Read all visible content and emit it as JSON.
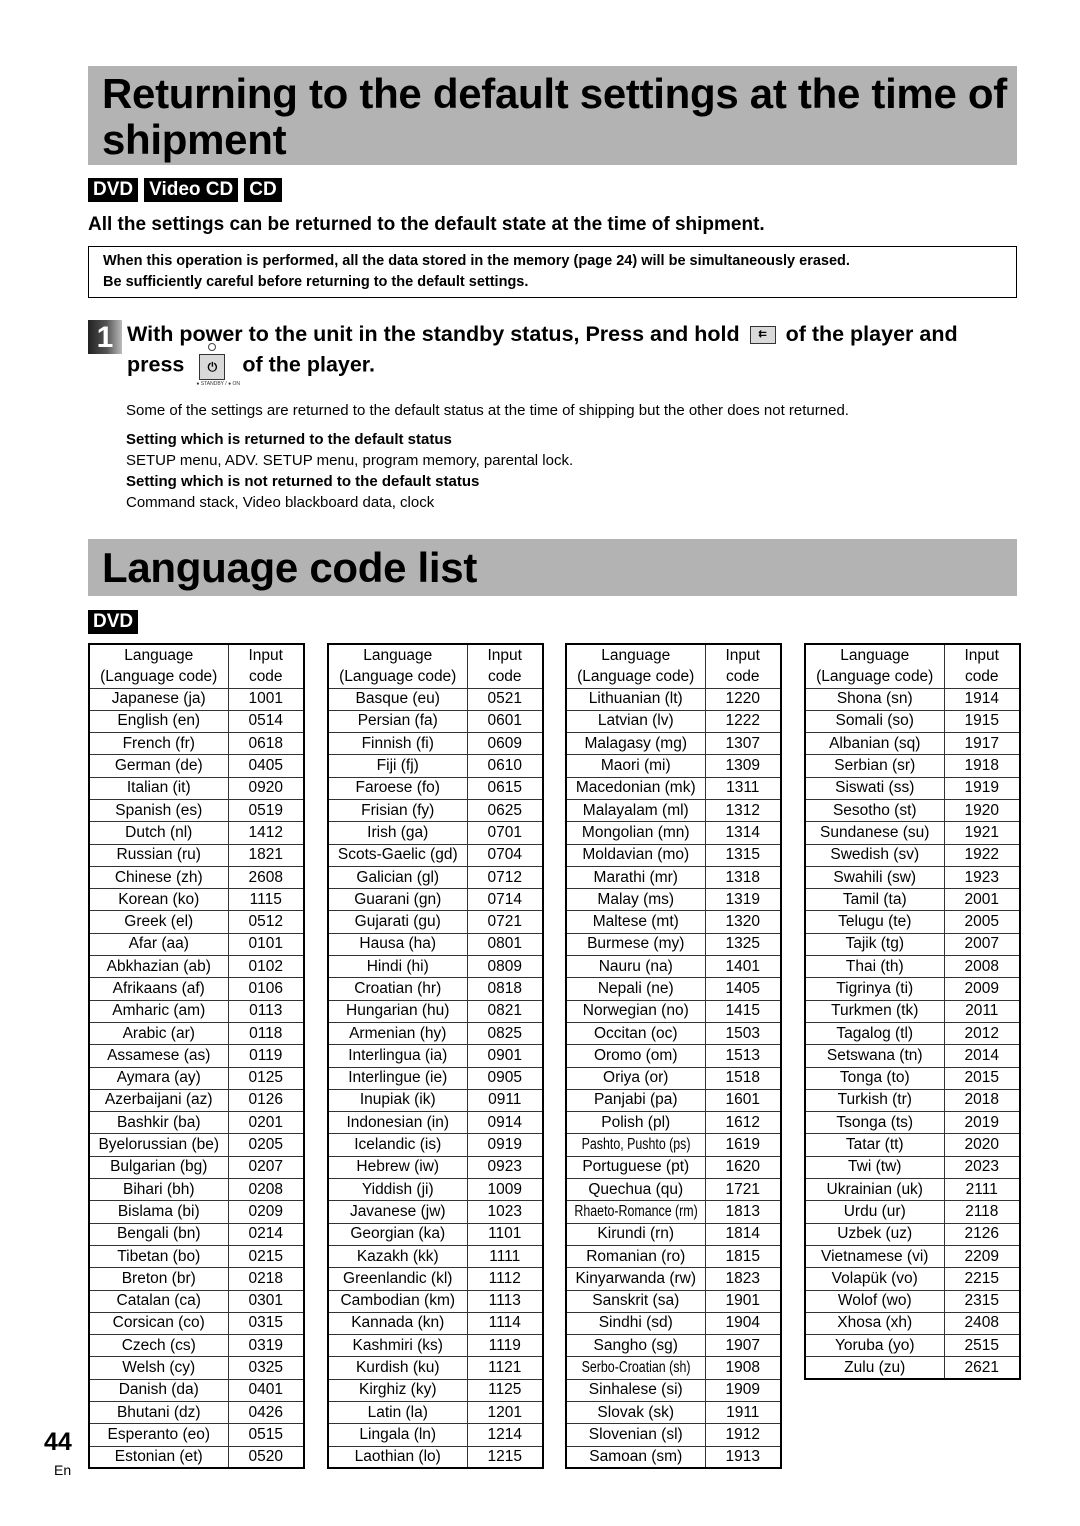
{
  "section1": {
    "title": "Returning to the default settings at the time of shipment",
    "badges": [
      "DVD",
      "Video CD",
      "CD"
    ],
    "lead": "All the settings can be returned to the default state at the time of shipment.",
    "warning_lines": [
      "When this operation is performed, all the data stored in the memory (page 24) will be simultaneously erased.",
      "Be sufficiently careful before returning to the default settings."
    ],
    "step": {
      "number": "1",
      "line1_before": "With power to the unit in the standby status, Press and hold",
      "line1_after": "of the player and",
      "line2_before": "press",
      "line2_after": "of the player.",
      "skip_icon_glyph": "⇇",
      "power_icon_glyph": "⏻",
      "power_label": "● STANDBY / ● ON"
    },
    "note": "Some of the settings are returned to the default status at the time of shipping but the other does not returned.",
    "returned_heading": "Setting which is returned to the default status",
    "returned_value": "SETUP menu, ADV. SETUP menu, program memory, parental lock.",
    "not_returned_heading": "Setting which is not returned to the default status",
    "not_returned_value": "Command stack, Video blackboard data, clock"
  },
  "section2": {
    "title": "Language code list",
    "badge": "DVD",
    "header": {
      "language_line1": "Language",
      "language_line2": "(Language code)",
      "code_line1": "Input",
      "code_line2": "code"
    },
    "tables": [
      [
        [
          "Japanese (ja)",
          "1001"
        ],
        [
          "English (en)",
          "0514"
        ],
        [
          "French (fr)",
          "0618"
        ],
        [
          "German (de)",
          "0405"
        ],
        [
          "Italian (it)",
          "0920"
        ],
        [
          "Spanish (es)",
          "0519"
        ],
        [
          "Dutch (nl)",
          "1412"
        ],
        [
          "Russian (ru)",
          "1821"
        ],
        [
          "Chinese (zh)",
          "2608"
        ],
        [
          "Korean (ko)",
          "1115"
        ],
        [
          "Greek (el)",
          "0512"
        ],
        [
          "Afar (aa)",
          "0101"
        ],
        [
          "Abkhazian (ab)",
          "0102"
        ],
        [
          "Afrikaans (af)",
          "0106"
        ],
        [
          "Amharic (am)",
          "0113"
        ],
        [
          "Arabic (ar)",
          "0118"
        ],
        [
          "Assamese (as)",
          "0119"
        ],
        [
          "Aymara (ay)",
          "0125"
        ],
        [
          "Azerbaijani (az)",
          "0126"
        ],
        [
          "Bashkir (ba)",
          "0201"
        ],
        [
          "Byelorussian (be)",
          "0205"
        ],
        [
          "Bulgarian (bg)",
          "0207"
        ],
        [
          "Bihari (bh)",
          "0208"
        ],
        [
          "Bislama (bi)",
          "0209"
        ],
        [
          "Bengali (bn)",
          "0214"
        ],
        [
          "Tibetan (bo)",
          "0215"
        ],
        [
          "Breton (br)",
          "0218"
        ],
        [
          "Catalan (ca)",
          "0301"
        ],
        [
          "Corsican (co)",
          "0315"
        ],
        [
          "Czech (cs)",
          "0319"
        ],
        [
          "Welsh (cy)",
          "0325"
        ],
        [
          "Danish (da)",
          "0401"
        ],
        [
          "Bhutani (dz)",
          "0426"
        ],
        [
          "Esperanto (eo)",
          "0515"
        ],
        [
          "Estonian (et)",
          "0520"
        ]
      ],
      [
        [
          "Basque (eu)",
          "0521"
        ],
        [
          "Persian (fa)",
          "0601"
        ],
        [
          "Finnish (fi)",
          "0609"
        ],
        [
          "Fiji (fj)",
          "0610"
        ],
        [
          "Faroese (fo)",
          "0615"
        ],
        [
          "Frisian (fy)",
          "0625"
        ],
        [
          "Irish (ga)",
          "0701"
        ],
        [
          "Scots-Gaelic (gd)",
          "0704"
        ],
        [
          "Galician (gl)",
          "0712"
        ],
        [
          "Guarani (gn)",
          "0714"
        ],
        [
          "Gujarati (gu)",
          "0721"
        ],
        [
          "Hausa (ha)",
          "0801"
        ],
        [
          "Hindi (hi)",
          "0809"
        ],
        [
          "Croatian (hr)",
          "0818"
        ],
        [
          "Hungarian (hu)",
          "0821"
        ],
        [
          "Armenian (hy)",
          "0825"
        ],
        [
          "Interlingua (ia)",
          "0901"
        ],
        [
          "Interlingue (ie)",
          "0905"
        ],
        [
          "Inupiak (ik)",
          "0911"
        ],
        [
          "Indonesian (in)",
          "0914"
        ],
        [
          "Icelandic (is)",
          "0919"
        ],
        [
          "Hebrew (iw)",
          "0923"
        ],
        [
          "Yiddish (ji)",
          "1009"
        ],
        [
          "Javanese (jw)",
          "1023"
        ],
        [
          "Georgian (ka)",
          "1101"
        ],
        [
          "Kazakh (kk)",
          "1111"
        ],
        [
          "Greenlandic (kl)",
          "1112"
        ],
        [
          "Cambodian (km)",
          "1113"
        ],
        [
          "Kannada (kn)",
          "1114"
        ],
        [
          "Kashmiri (ks)",
          "1119"
        ],
        [
          "Kurdish (ku)",
          "1121"
        ],
        [
          "Kirghiz (ky)",
          "1125"
        ],
        [
          "Latin (la)",
          "1201"
        ],
        [
          "Lingala (ln)",
          "1214"
        ],
        [
          "Laothian (lo)",
          "1215"
        ]
      ],
      [
        [
          "Lithuanian (lt)",
          "1220"
        ],
        [
          "Latvian (lv)",
          "1222"
        ],
        [
          "Malagasy (mg)",
          "1307"
        ],
        [
          "Maori (mi)",
          "1309"
        ],
        [
          "Macedonian (mk)",
          "1311"
        ],
        [
          "Malayalam (ml)",
          "1312"
        ],
        [
          "Mongolian (mn)",
          "1314"
        ],
        [
          "Moldavian (mo)",
          "1315"
        ],
        [
          "Marathi (mr)",
          "1318"
        ],
        [
          "Malay (ms)",
          "1319"
        ],
        [
          "Maltese (mt)",
          "1320"
        ],
        [
          "Burmese (my)",
          "1325"
        ],
        [
          "Nauru (na)",
          "1401"
        ],
        [
          "Nepali (ne)",
          "1405"
        ],
        [
          "Norwegian (no)",
          "1415"
        ],
        [
          "Occitan (oc)",
          "1503"
        ],
        [
          "Oromo (om)",
          "1513"
        ],
        [
          "Oriya (or)",
          "1518"
        ],
        [
          "Panjabi (pa)",
          "1601"
        ],
        [
          "Polish (pl)",
          "1612"
        ],
        [
          "Pashto, Pushto (ps)",
          "1619"
        ],
        [
          "Portuguese (pt)",
          "1620"
        ],
        [
          "Quechua (qu)",
          "1721"
        ],
        [
          "Rhaeto-Romance (rm)",
          "1813"
        ],
        [
          "Kirundi (rn)",
          "1814"
        ],
        [
          "Romanian (ro)",
          "1815"
        ],
        [
          "Kinyarwanda (rw)",
          "1823"
        ],
        [
          "Sanskrit (sa)",
          "1901"
        ],
        [
          "Sindhi (sd)",
          "1904"
        ],
        [
          "Sangho (sg)",
          "1907"
        ],
        [
          "Serbo-Croatian (sh)",
          "1908"
        ],
        [
          "Sinhalese (si)",
          "1909"
        ],
        [
          "Slovak (sk)",
          "1911"
        ],
        [
          "Slovenian (sl)",
          "1912"
        ],
        [
          "Samoan (sm)",
          "1913"
        ]
      ],
      [
        [
          "Shona (sn)",
          "1914"
        ],
        [
          "Somali (so)",
          "1915"
        ],
        [
          "Albanian (sq)",
          "1917"
        ],
        [
          "Serbian (sr)",
          "1918"
        ],
        [
          "Siswati (ss)",
          "1919"
        ],
        [
          "Sesotho (st)",
          "1920"
        ],
        [
          "Sundanese (su)",
          "1921"
        ],
        [
          "Swedish (sv)",
          "1922"
        ],
        [
          "Swahili (sw)",
          "1923"
        ],
        [
          "Tamil (ta)",
          "2001"
        ],
        [
          "Telugu (te)",
          "2005"
        ],
        [
          "Tajik (tg)",
          "2007"
        ],
        [
          "Thai (th)",
          "2008"
        ],
        [
          "Tigrinya (ti)",
          "2009"
        ],
        [
          "Turkmen (tk)",
          "2011"
        ],
        [
          "Tagalog (tl)",
          "2012"
        ],
        [
          "Setswana (tn)",
          "2014"
        ],
        [
          "Tonga (to)",
          "2015"
        ],
        [
          "Turkish (tr)",
          "2018"
        ],
        [
          "Tsonga (ts)",
          "2019"
        ],
        [
          "Tatar (tt)",
          "2020"
        ],
        [
          "Twi (tw)",
          "2023"
        ],
        [
          "Ukrainian (uk)",
          "2111"
        ],
        [
          "Urdu (ur)",
          "2118"
        ],
        [
          "Uzbek (uz)",
          "2126"
        ],
        [
          "Vietnamese (vi)",
          "2209"
        ],
        [
          "Volapük (vo)",
          "2215"
        ],
        [
          "Wolof (wo)",
          "2315"
        ],
        [
          "Xhosa (xh)",
          "2408"
        ],
        [
          "Yoruba (yo)",
          "2515"
        ],
        [
          "Zulu (zu)",
          "2621"
        ]
      ]
    ],
    "condensed_entries": [
      "Pashto, Pushto (ps)",
      "Rhaeto-Romance (rm)",
      "Serbo-Croatian (sh)"
    ]
  },
  "footer": {
    "page_number": "44",
    "language": "En"
  }
}
